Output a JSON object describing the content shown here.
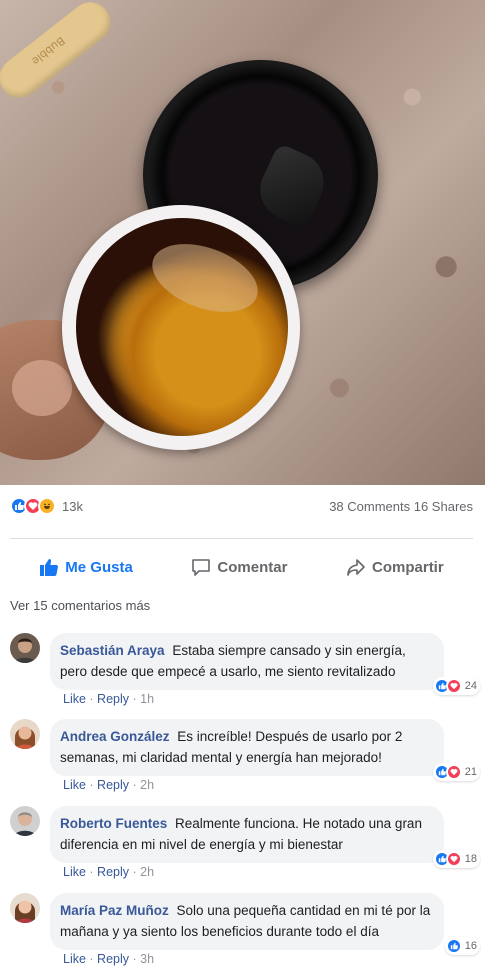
{
  "stick_text": "Bubble",
  "reactions": {
    "icons": [
      "like-icon",
      "love-icon",
      "haha-icon"
    ],
    "count": "13k",
    "stats": "38 Comments 16 Shares"
  },
  "actions": {
    "like": "Me Gusta",
    "comment": "Comentar",
    "share": "Compartir"
  },
  "view_more": "Ver 15 comentarios más",
  "comments": [
    {
      "name": "Sebastián Araya",
      "text": "Estaba siempre cansado y sin energía, pero desde que empecé a usarlo, me siento revitalizado",
      "like": "Like",
      "reply": "Reply",
      "time": "1h",
      "reaction_count": "24"
    },
    {
      "name": "Andrea González",
      "text": "Es increíble! Después de usarlo por 2 semanas, mi claridad mental y energía han mejorado!",
      "like": "Like",
      "reply": "Reply",
      "time": "2h",
      "reaction_count": "21"
    },
    {
      "name": "Roberto Fuentes",
      "text": "Realmente funciona. He notado una gran diferencia en mi nivel de energía y mi bienestar",
      "like": "Like",
      "reply": "Reply",
      "time": "2h",
      "reaction_count": "18"
    },
    {
      "name": "María Paz Muñoz",
      "text": "Solo una pequeña cantidad en mi té por la mañana y ya siento los beneficios durante todo el día",
      "like": "Like",
      "reply": "Reply",
      "time": "3h",
      "reaction_count": "16"
    }
  ],
  "colors": {
    "facebook_blue": "#1877f2",
    "name_blue": "#385898",
    "love_red": "#f33e58",
    "haha_yellow": "#f7b125"
  }
}
